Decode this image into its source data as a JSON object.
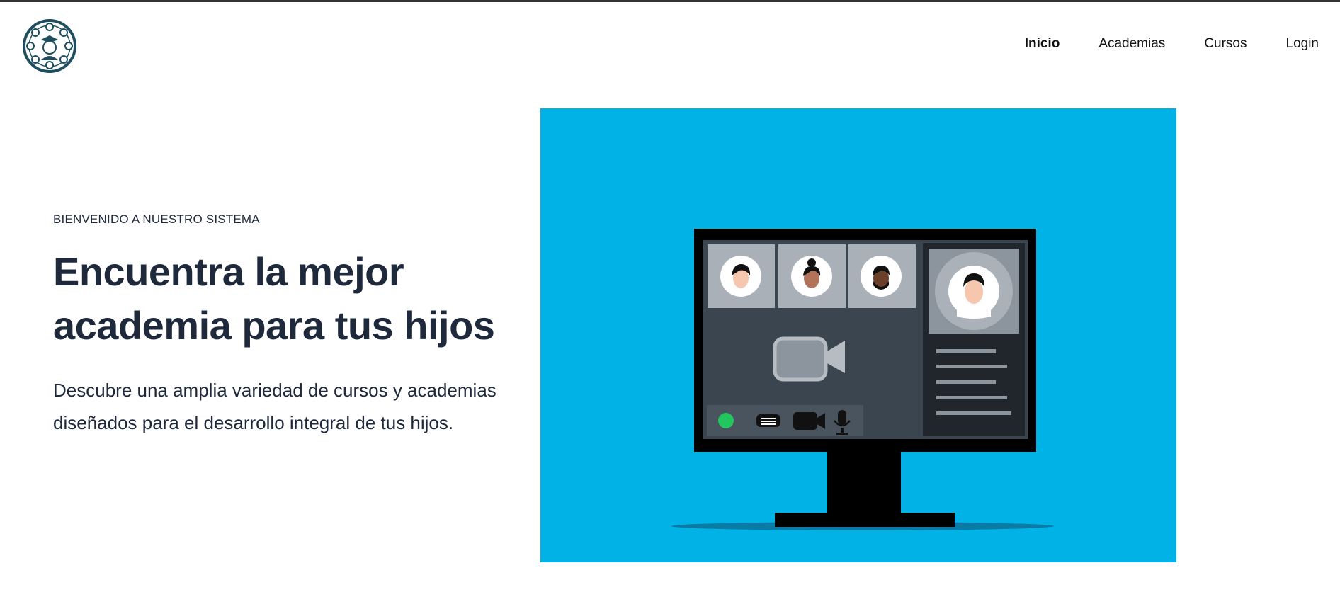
{
  "header": {
    "logo_icon": "academy-logo-icon",
    "nav": [
      {
        "label": "Inicio",
        "active": true
      },
      {
        "label": "Academias",
        "active": false
      },
      {
        "label": "Cursos",
        "active": false
      },
      {
        "label": "Login",
        "active": false
      }
    ]
  },
  "hero": {
    "eyebrow": "BIENVENIDO A NUESTRO SISTEMA",
    "title_line1": "Encuentra la mejor",
    "title_line2": "academia para tus hijos",
    "subtitle_line1": "Descubre una amplia variedad de cursos y academias",
    "subtitle_line2": "diseñados para el desarrollo integral de tus hijos.",
    "illustration": "video-conference-monitor-illustration",
    "image_bg_color": "#00b2e5"
  },
  "colors": {
    "text": "#1e293b",
    "accent_green": "#22c55e"
  }
}
